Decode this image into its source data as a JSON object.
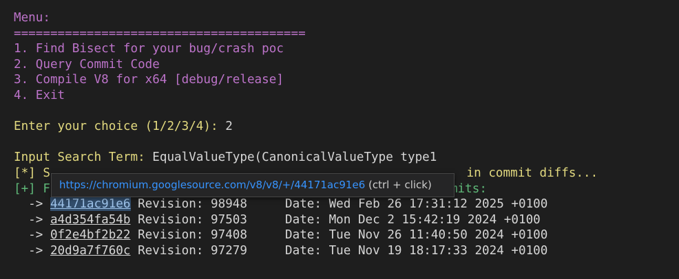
{
  "menu": {
    "title": "Menu:",
    "separator": "========================================",
    "items": [
      "1. Find Bisect for your bug/crash poc",
      "2. Query Commit Code",
      "3. Compile V8 for x64 [debug/release]",
      "4. Exit"
    ]
  },
  "choice": {
    "prompt": "Enter your choice (1/2/3/4): ",
    "value": "2"
  },
  "search": {
    "prompt": "Input Search Term: ",
    "term": "EqualValueType(CanonicalValueType type1",
    "status_visible_start": "[*] S",
    "status_visible_end": " in commit diffs...",
    "found_visible_start": "[+] F",
    "found_visible_end": "mits:"
  },
  "commits": [
    {
      "hash": "44171ac91e6",
      "revision": "98948",
      "date": "Wed Feb 26 17:31:12 2025 +0100"
    },
    {
      "hash": "a4d354fa54b",
      "revision": "97503",
      "date": "Mon Dec 2 15:42:19 2024 +0100"
    },
    {
      "hash": "0f2e4bf2b22",
      "revision": "97408",
      "date": "Tue Nov 26 11:40:50 2024 +0100"
    },
    {
      "hash": "20d9a7f760c",
      "revision": "97279",
      "date": "Tue Nov 19 18:17:33 2024 +0100"
    }
  ],
  "labels": {
    "arrow": "  -> ",
    "revision": " Revision: ",
    "date": "Date: "
  },
  "tooltip": {
    "url": "https://chromium.googlesource.com/v8/v8/+/44171ac91e6",
    "hint": " (ctrl + click)"
  },
  "colors": {
    "background": "#1e1e1e",
    "menu": "#bc73c9",
    "prompt": "#e2d97f",
    "success": "#5fb878",
    "link": "#3794ff"
  }
}
